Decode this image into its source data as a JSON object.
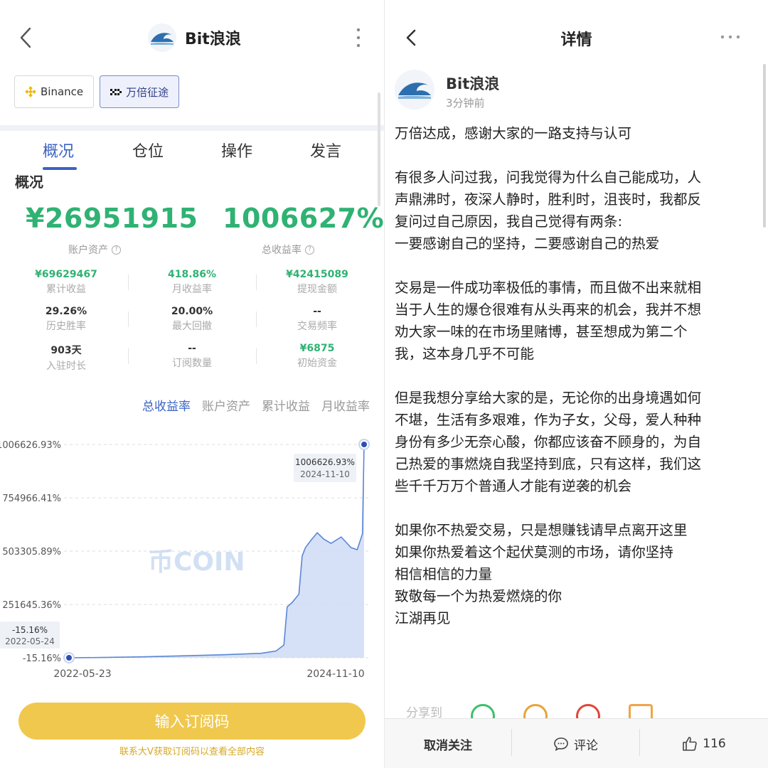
{
  "left": {
    "profile": {
      "name": "Bit浪浪"
    },
    "exchanges": [
      {
        "label": "Binance",
        "icon": "binance-icon",
        "active": false
      },
      {
        "label": "万倍征途",
        "icon": "okx-icon",
        "active": true
      }
    ],
    "tabs": [
      "概况",
      "仓位",
      "操作",
      "发言"
    ],
    "section_title": "概况",
    "account_assets": {
      "value": "¥26951915",
      "label": "账户资产"
    },
    "total_return": {
      "value": "1006627%",
      "label": "总收益率"
    },
    "stats": [
      {
        "value": "¥69629467",
        "label": "累计收益"
      },
      {
        "value": "418.86%",
        "label": "月收益率"
      },
      {
        "value": "¥42415089",
        "label": "提现金额"
      },
      {
        "value": "29.26%",
        "label": "历史胜率"
      },
      {
        "value": "20.00%",
        "label": "最大回撤"
      },
      {
        "value": "--",
        "label": "交易频率"
      },
      {
        "value": "903天",
        "label": "入驻时长"
      },
      {
        "value": "--",
        "label": "订阅数量"
      },
      {
        "value": "¥6875",
        "label": "初始资金"
      }
    ],
    "metric_tabs": [
      "总收益率",
      "账户资产",
      "累计收益",
      "月收益率"
    ],
    "watermark": "币COIN",
    "subscribe_button": "输入订阅码",
    "subscribe_hint": "联系大V获取订阅码以查看全部内容",
    "colors": {
      "green": "#2fb273",
      "blue": "#3b63c4",
      "yellow": "#f0c84d"
    }
  },
  "chart_data": {
    "type": "area",
    "y_tick_labels": [
      "1006626.93%",
      "754966.41%",
      "503305.89%",
      "251645.36%",
      "-15.16%"
    ],
    "ylim": [
      -15.16,
      1006626.93
    ],
    "x_tick_labels": [
      "2022-05-23",
      "2024-11-10"
    ],
    "start_tooltip": {
      "value": "-15.16%",
      "date": "2022-05-24"
    },
    "end_tooltip": {
      "value": "1006626.93%",
      "date": "2024-11-10"
    },
    "series": [
      {
        "points": [
          [
            "2022-05-24",
            -15.16
          ],
          [
            "2022-09-01",
            1200
          ],
          [
            "2023-01-01",
            4500
          ],
          [
            "2023-05-01",
            9000
          ],
          [
            "2023-09-01",
            14000
          ],
          [
            "2024-01-01",
            21000
          ],
          [
            "2024-02-15",
            32000
          ],
          [
            "2024-03-10",
            60000
          ],
          [
            "2024-03-20",
            240000
          ],
          [
            "2024-04-05",
            262000
          ],
          [
            "2024-04-25",
            300000
          ],
          [
            "2024-05-05",
            480000
          ],
          [
            "2024-05-15",
            520000
          ],
          [
            "2024-06-01",
            555000
          ],
          [
            "2024-06-20",
            590000
          ],
          [
            "2024-07-10",
            560000
          ],
          [
            "2024-08-01",
            540000
          ],
          [
            "2024-09-01",
            570000
          ],
          [
            "2024-10-01",
            520000
          ],
          [
            "2024-10-20",
            510000
          ],
          [
            "2024-11-05",
            585000
          ],
          [
            "2024-11-10",
            1006626.93
          ]
        ]
      }
    ]
  },
  "right": {
    "title": "详情",
    "author": "Bit浪浪",
    "time": "3分钟前",
    "paragraphs": [
      "万倍达成，感谢大家的一路支持与认可",
      "有很多人问过我，问我觉得为什么自己能成功，人\n声鼎沸时，夜深人静时，胜利时，沮丧时，我都反\n复问过自己原因，我自己觉得有两条:\n一要感谢自己的坚持，二要感谢自己的热爱",
      "交易是一件成功率极低的事情，而且做不出来就相\n当于人生的爆仓很难有从头再来的机会，我并不想\n劝大家一味的在市场里赌博，甚至想成为第二个\n我，这本身几乎不可能",
      "但是我想分享给大家的是，无论你的出身境遇如何\n不堪，生活有多艰难，作为子女，父母，爱人种种\n身份有多少无奈心酸，你都应该奋不顾身的，为自\n己热爱的事燃烧自我坚持到底，只有这样，我们这\n些千千万万个普通人才能有逆袭的机会",
      "如果你不热爱交易，只是想赚钱请早点离开这里\n如果你热爱着这个起伏莫测的市场，请你坚持\n相信相信的力量\n致敬每一个为热爱燃烧的你\n江湖再见"
    ],
    "share_label": "分享到",
    "bottom": {
      "unfollow": "取消关注",
      "comment": "评论",
      "likes": "116"
    }
  }
}
